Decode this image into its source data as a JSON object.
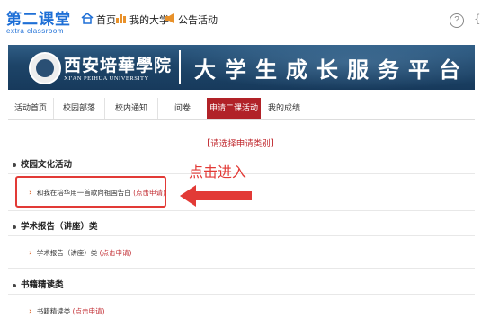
{
  "logo": {
    "main": "第二课堂",
    "sub": "extra classroom"
  },
  "topnav": [
    {
      "icon": "home-icon",
      "label": "首页"
    },
    {
      "icon": "university-icon",
      "label": "我的大学"
    },
    {
      "icon": "announcement-icon",
      "label": "公告活动"
    }
  ],
  "banner": {
    "school_cn": "西安培華學院",
    "school_en": "XI'AN PEIHUA UNIVERSITY",
    "slogan": "大学生成长服务平台"
  },
  "tabs": [
    "活动首页",
    "校园部落",
    "校内通知",
    "问卷",
    "申请二课活动",
    "我的成绩"
  ],
  "active_tab": "申请二课活动",
  "section_title": "【请选择申请类别】",
  "categories": [
    {
      "name": "校园文化活动",
      "item": "和我在培华用一首歌向祖国告白",
      "apply": "(点击申请)"
    },
    {
      "name": "学术报告（讲座）类",
      "item": "学术报告（讲座）类",
      "apply": "(点击申请)"
    },
    {
      "name": "书籍精读类",
      "item": "书籍精读类",
      "apply": "(点击申请)"
    }
  ],
  "annotation": {
    "label": "点击进入"
  },
  "colors": {
    "brand_blue": "#1e6fd6",
    "active_tab": "#b12228",
    "accent_red": "#e23a36"
  }
}
